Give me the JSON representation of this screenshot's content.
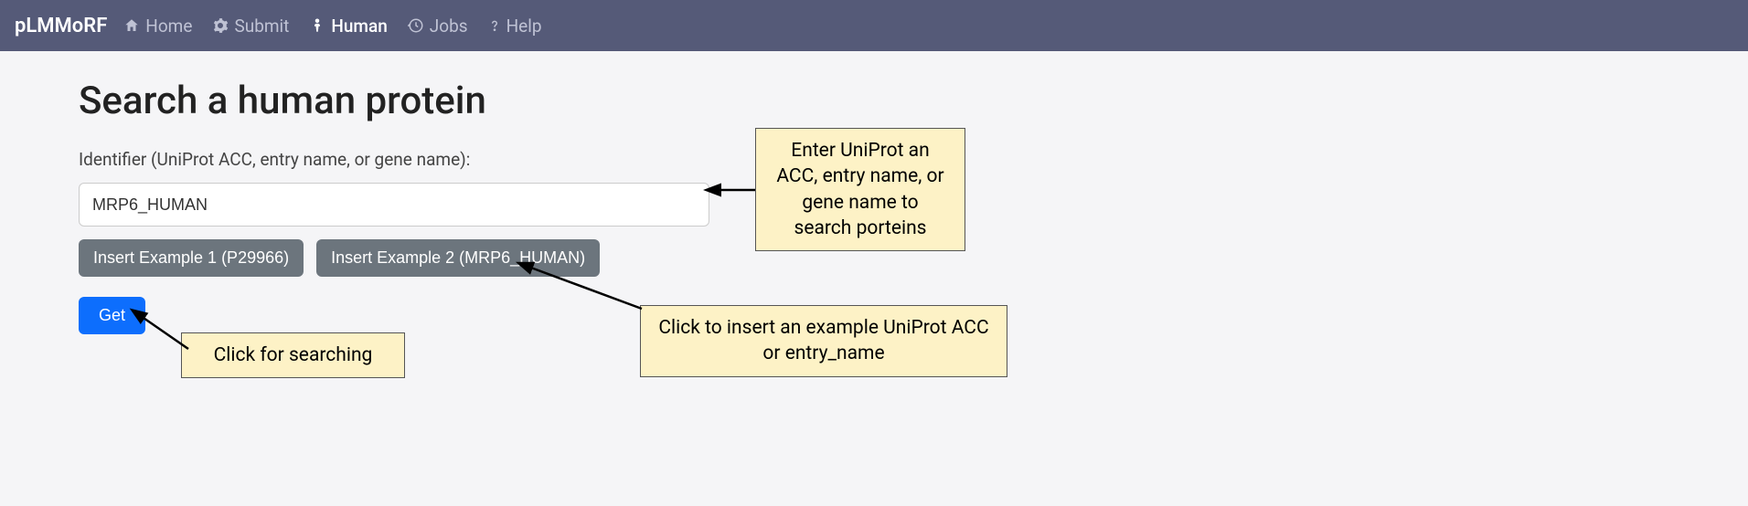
{
  "nav": {
    "brand": "pLMMoRF",
    "items": [
      {
        "label": "Home"
      },
      {
        "label": "Submit"
      },
      {
        "label": "Human"
      },
      {
        "label": "Jobs"
      },
      {
        "label": "Help"
      }
    ]
  },
  "page": {
    "title": "Search a human protein",
    "identifier_label": "Identifier (UniProt ACC, entry name, or gene name):",
    "identifier_value": "MRP6_HUMAN",
    "example1_label": "Insert Example 1 (P29966)",
    "example2_label": "Insert Example 2 (MRP6_HUMAN)",
    "get_label": "Get"
  },
  "annotations": {
    "callout1": "Enter UniProt an ACC, entry name, or gene name to search porteins",
    "callout2": "Click to insert an example UniProt ACC or entry_name",
    "callout3": "Click for searching"
  }
}
